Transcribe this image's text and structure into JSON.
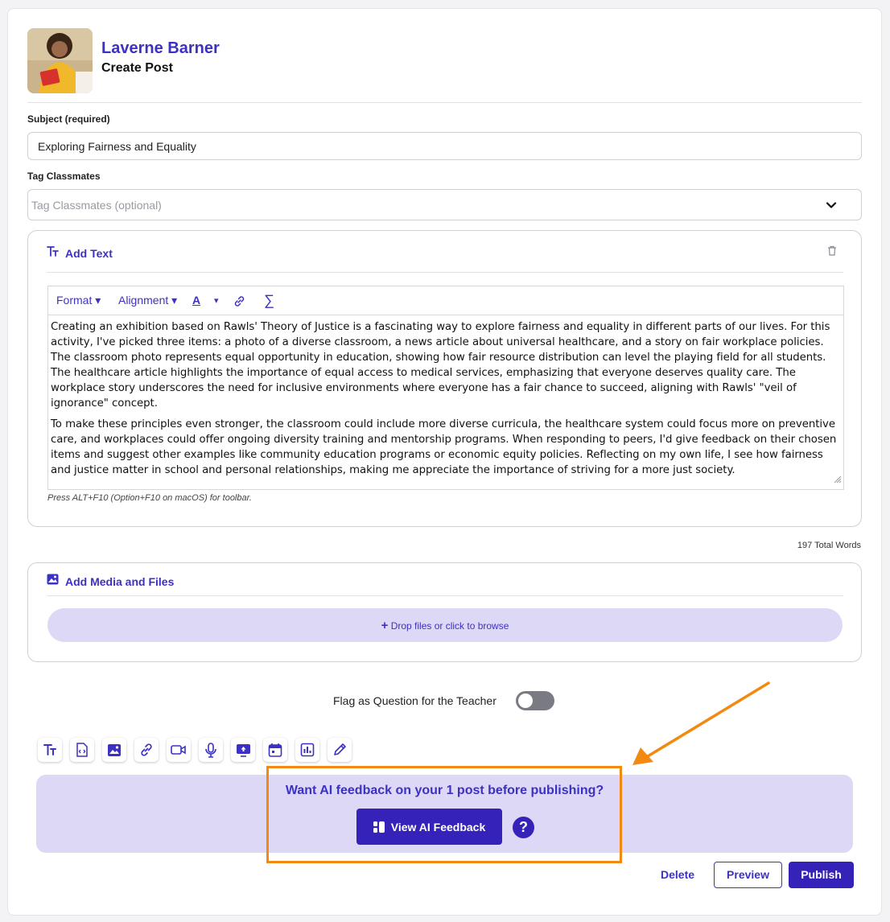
{
  "header": {
    "user_name": "Laverne Barner",
    "page_title": "Create Post"
  },
  "subject": {
    "label": "Subject (required)",
    "value": "Exploring Fairness and Equality"
  },
  "tags": {
    "label": "Tag Classmates",
    "placeholder": "Tag Classmates (optional)"
  },
  "text_block": {
    "title": "Add Text",
    "toolbar": {
      "format": "Format",
      "alignment": "Alignment",
      "font_color": "A",
      "formula": "∑"
    },
    "paragraphs": [
      "Creating an exhibition based on Rawls' Theory of Justice is a fascinating way to explore fairness and equality in different parts of our lives. For this activity, I've picked three items: a photo of a diverse classroom, a news article about universal healthcare, and a story on fair workplace policies. The classroom photo represents equal opportunity in education, showing how fair resource distribution can level the playing field for all students. The healthcare article highlights the importance of equal access to medical services, emphasizing that everyone deserves quality care. The workplace story underscores the need for inclusive environments where everyone has a fair chance to succeed, aligning with Rawls' \"veil of ignorance\" concept.",
      "To make these principles even stronger, the classroom could include more diverse curricula, the healthcare system could focus more on preventive care, and workplaces could offer ongoing diversity training and mentorship programs. When responding to peers, I'd give feedback on their chosen items and suggest other examples like community education programs or economic equity policies. Reflecting on my own life, I see how fairness and justice matter in school and personal relationships, making me appreciate the importance of striving for a more just society."
    ],
    "hint": "Press ALT+F10 (Option+F10 on macOS) for toolbar.",
    "word_count": "197 Total Words"
  },
  "media_block": {
    "title": "Add Media and Files",
    "dropzone": "Drop files or click to browse"
  },
  "flag": {
    "label": "Flag as Question for the Teacher",
    "on": false
  },
  "insert_icons": [
    "text-icon",
    "code-file-icon",
    "image-icon",
    "link-icon",
    "video-icon",
    "microphone-icon",
    "screen-share-icon",
    "calendar-icon",
    "poll-chart-icon",
    "pencil-icon"
  ],
  "ai_feedback": {
    "prompt": "Want AI feedback on your 1 post before publishing?",
    "button": "View AI Feedback",
    "help": "?"
  },
  "actions": {
    "delete": "Delete",
    "preview": "Preview",
    "publish": "Publish"
  },
  "colors": {
    "accent": "#3d31c4",
    "accent_dark": "#3522b8",
    "banner_bg": "#dcd8f6",
    "highlight_orange": "#f28a12"
  }
}
